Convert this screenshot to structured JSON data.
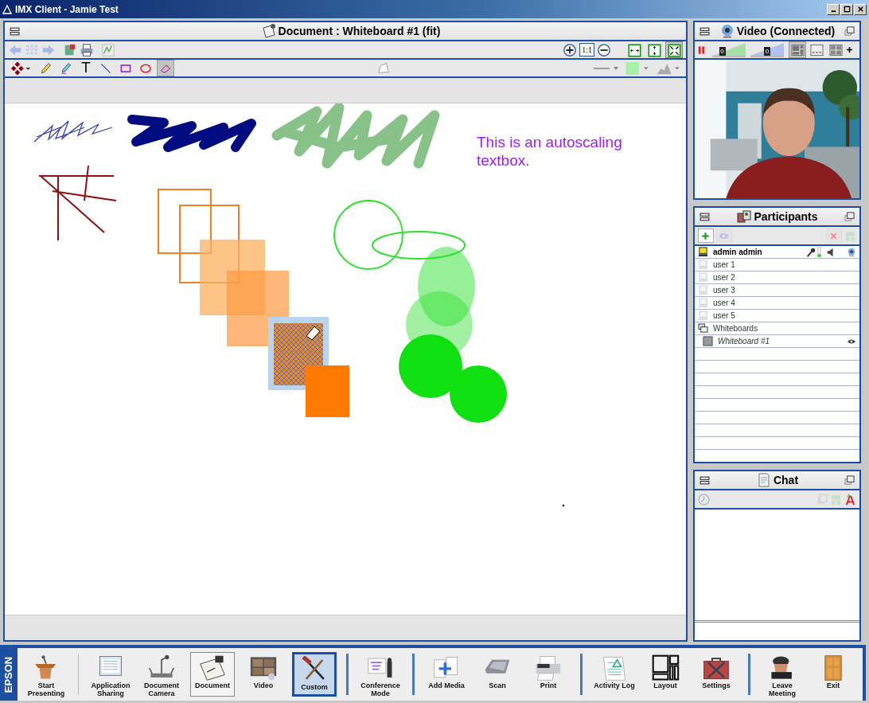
{
  "window": {
    "title": "IMX Client - Jamie Test"
  },
  "document_panel": {
    "title": "Document : Whiteboard #1 (fit)",
    "zoom_buttons": [
      {
        "kind": "zoom-in"
      },
      {
        "kind": "actual",
        "label": "1:1"
      },
      {
        "kind": "zoom-out"
      }
    ],
    "fit_buttons": [
      {
        "kind": "fit-width",
        "selected": false
      },
      {
        "kind": "fit-height",
        "selected": false
      },
      {
        "kind": "fit-page",
        "selected": true
      }
    ],
    "tools": [
      {
        "kind": "fill",
        "selected": false
      },
      {
        "kind": "pencil",
        "selected": false
      },
      {
        "kind": "highlighter",
        "selected": false
      },
      {
        "kind": "text",
        "label": "T",
        "selected": false
      },
      {
        "kind": "line",
        "selected": false
      },
      {
        "kind": "rectangle",
        "selected": false
      },
      {
        "kind": "ellipse",
        "selected": false
      },
      {
        "kind": "eraser",
        "selected": true
      }
    ],
    "textbox": "This is an autoscaling textbox."
  },
  "video_panel": {
    "title": "Video (Connected)",
    "paused": true,
    "sliders": [
      {
        "kind": "mic",
        "level": 0.25,
        "reading": "0"
      },
      {
        "kind": "speaker",
        "level": 0.5,
        "reading": "0"
      }
    ],
    "layouts": [
      {
        "kind": "grid",
        "selected": true
      },
      {
        "kind": "strip",
        "selected": false
      },
      {
        "kind": "quad",
        "selected": false
      }
    ]
  },
  "participants_panel": {
    "title": "Participants",
    "people": [
      {
        "name": "admin admin",
        "active": true
      },
      {
        "name": "user 1",
        "active": false
      },
      {
        "name": "user 2",
        "active": false
      },
      {
        "name": "user 3",
        "active": false
      },
      {
        "name": "user 4",
        "active": false
      },
      {
        "name": "user 5",
        "active": false
      }
    ],
    "groups": [
      {
        "name": "Whiteboards",
        "children": [
          {
            "name": "Whiteboard #1",
            "viewing": true
          }
        ]
      }
    ]
  },
  "chat_panel": {
    "title": "Chat"
  },
  "brand": "EPSON",
  "toolbar": [
    [
      {
        "kind": "podium",
        "label": "Start\nPresenting",
        "selected": false
      }
    ],
    [
      {
        "kind": "sharing",
        "label": "Application\nSharing",
        "selected": false
      },
      {
        "kind": "camera",
        "label": "Document\nCamera",
        "selected": false
      },
      {
        "kind": "document",
        "label": "Document",
        "selected": true
      },
      {
        "kind": "video",
        "label": "Video",
        "selected": false
      },
      {
        "kind": "tools",
        "label": "Custom",
        "selected": false,
        "highlighted": true
      }
    ],
    [
      {
        "kind": "conference",
        "label": "Conference\nMode",
        "selected": false
      }
    ],
    [
      {
        "kind": "media",
        "label": "Add Media",
        "selected": false
      },
      {
        "kind": "scanner",
        "label": "Scan",
        "selected": false
      },
      {
        "kind": "printer",
        "label": "Print",
        "selected": false
      }
    ],
    [
      {
        "kind": "log",
        "label": "Activity Log",
        "selected": false
      },
      {
        "kind": "layout",
        "label": "Layout",
        "selected": false
      },
      {
        "kind": "settings",
        "label": "Settings",
        "selected": false
      }
    ],
    [
      {
        "kind": "leave",
        "label": "Leave\nMeeting",
        "selected": false
      },
      {
        "kind": "door",
        "label": "Exit",
        "selected": false
      }
    ]
  ]
}
